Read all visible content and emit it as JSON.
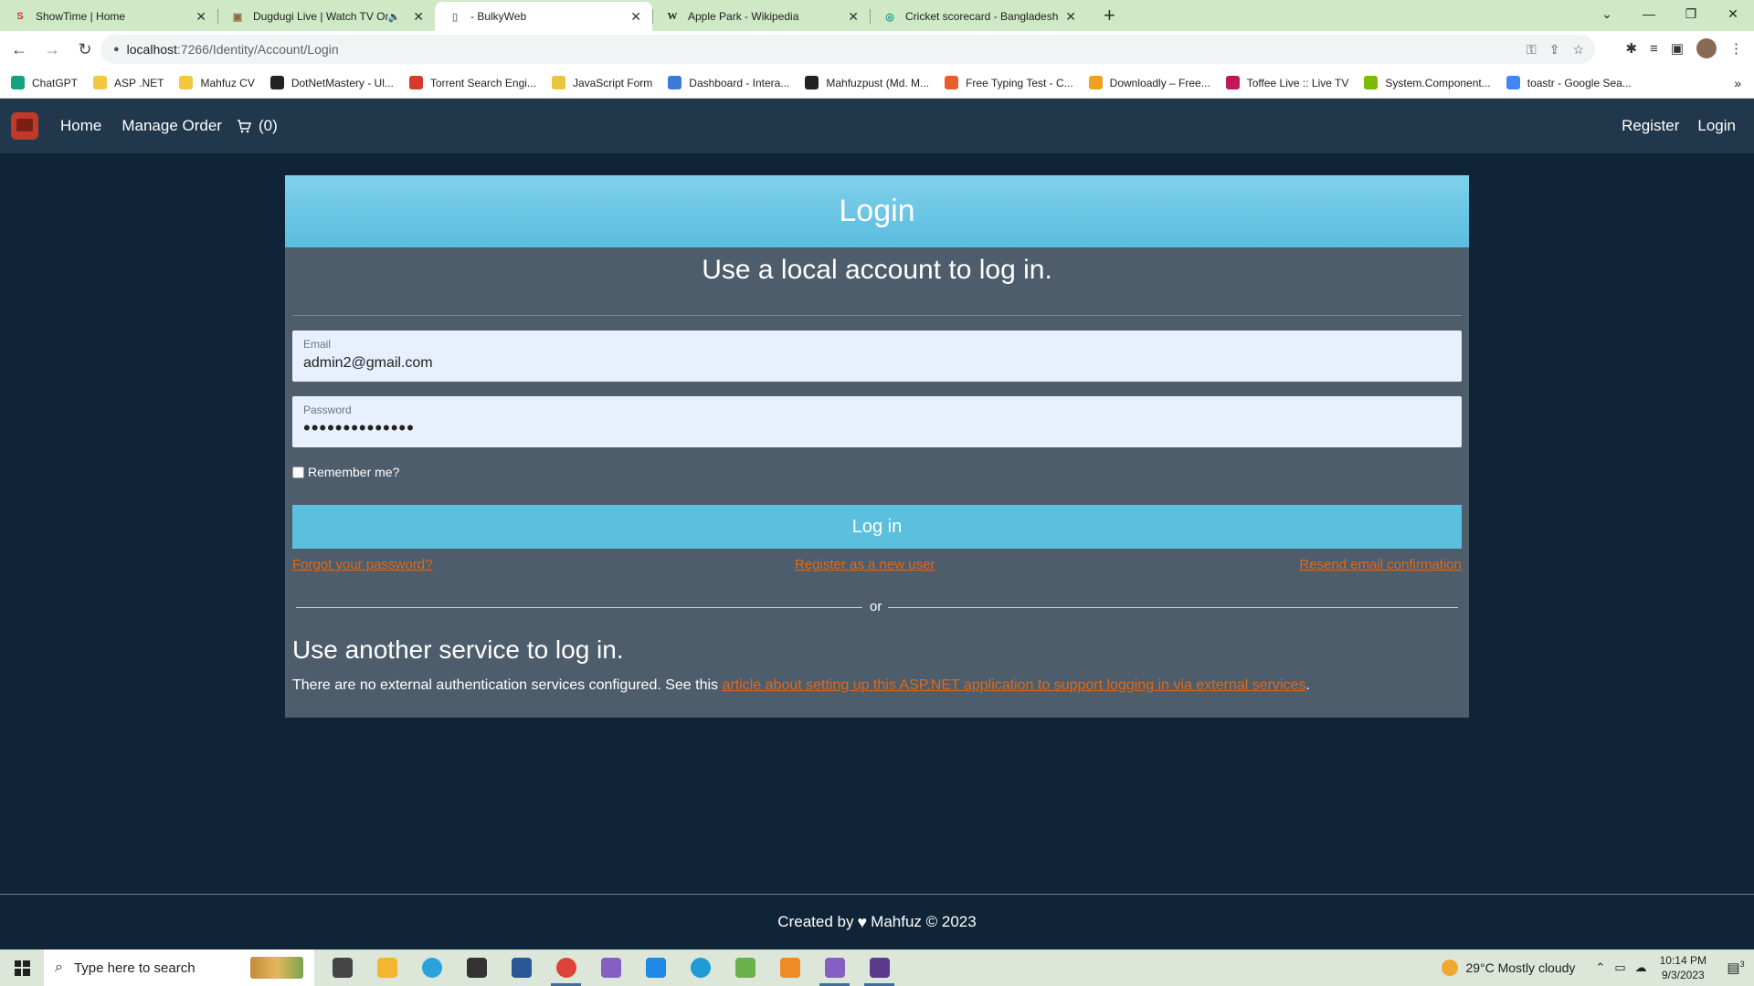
{
  "browser": {
    "tabs": [
      {
        "title": "ShowTime | Home",
        "icon": "showtime-icon",
        "active": false,
        "muted": false
      },
      {
        "title": "Dugdugi Live | Watch TV Onl",
        "icon": "dugdugi-icon",
        "active": false,
        "muted": true
      },
      {
        "title": "- BulkyWeb",
        "icon": "document-icon",
        "active": true,
        "muted": false
      },
      {
        "title": "Apple Park - Wikipedia",
        "icon": "wikipedia-icon",
        "active": false,
        "muted": false
      },
      {
        "title": "Cricket scorecard - Bangladesh v",
        "icon": "cricket-icon",
        "active": false,
        "muted": false
      }
    ],
    "url_host": "localhost",
    "url_path": ":7266/Identity/Account/Login",
    "bookmarks": [
      {
        "label": "ChatGPT",
        "color": "#10a37f"
      },
      {
        "label": "ASP .NET",
        "color": "#f2c744"
      },
      {
        "label": "Mahfuz CV",
        "color": "#f2c744"
      },
      {
        "label": "DotNetMastery - Ul...",
        "color": "#222222"
      },
      {
        "label": "Torrent Search Engi...",
        "color": "#d63a2a"
      },
      {
        "label": "JavaScript Form",
        "color": "#e8c53a"
      },
      {
        "label": "Dashboard - Intera...",
        "color": "#3a7bd5"
      },
      {
        "label": "Mahfuzpust (Md. M...",
        "color": "#222222"
      },
      {
        "label": "Free Typing Test - C...",
        "color": "#e85d2a"
      },
      {
        "label": "Downloadly – Free...",
        "color": "#f0a020"
      },
      {
        "label": "Toffee Live :: Live TV",
        "color": "#c2185b"
      },
      {
        "label": "System.Component...",
        "color": "#7cbb00"
      },
      {
        "label": "toastr - Google Sea...",
        "color": "#4285f4"
      }
    ]
  },
  "app": {
    "nav": {
      "home": "Home",
      "manage_order": "Manage Order",
      "cart_count": "(0)",
      "register": "Register",
      "login": "Login"
    },
    "login": {
      "header": "Login",
      "subtitle": "Use a local account to log in.",
      "email_label": "Email",
      "email_value": "admin2@gmail.com",
      "password_label": "Password",
      "password_value": "••••••••••••••",
      "remember_label": "Remember me?",
      "login_button": "Log in",
      "forgot_link": "Forgot your password?",
      "register_link": "Register as a new user",
      "resend_link": "Resend email confirmation",
      "or_text": "or",
      "external_title": "Use another service to log in.",
      "external_text": "There are no external authentication services configured. See this ",
      "external_link": "article about setting up this ASP.NET application to support logging in via external services",
      "external_end": "."
    },
    "footer": {
      "created_by": "Created by",
      "author": "Mahfuz © 2023"
    }
  },
  "taskbar": {
    "search_placeholder": "Type here to search",
    "weather": "29°C  Mostly cloudy",
    "time": "10:14 PM",
    "date": "9/3/2023",
    "notification_count": "3",
    "apps": [
      {
        "name": "task-view-icon",
        "color": "#444444"
      },
      {
        "name": "file-explorer-icon",
        "color": "#f2b632"
      },
      {
        "name": "telegram-icon",
        "color": "#2aa3dc"
      },
      {
        "name": "terminal-icon",
        "color": "#333333"
      },
      {
        "name": "powershell-icon",
        "color": "#2b5797"
      },
      {
        "name": "chrome-icon",
        "color": "#db4437"
      },
      {
        "name": "visual-studio-icon",
        "color": "#865fc5"
      },
      {
        "name": "vscode-icon",
        "color": "#1e88e5"
      },
      {
        "name": "edge-icon",
        "color": "#1f9bd6"
      },
      {
        "name": "snipping-tool-icon",
        "color": "#6ab04c"
      },
      {
        "name": "sublime-icon",
        "color": "#f08a24"
      },
      {
        "name": "visual-studio-2-icon",
        "color": "#865fc5"
      },
      {
        "name": "console-icon",
        "color": "#5b3a8c"
      }
    ],
    "colors": {
      "accent": "#3a6ea5"
    }
  },
  "colors": {
    "page_bg": "#0f2537",
    "navbar_bg": "#20374c",
    "card_bg": "#4e5d6c",
    "header_bg": "#5bbcdf",
    "button_bg": "#5bc0de",
    "link": "#df6919"
  }
}
